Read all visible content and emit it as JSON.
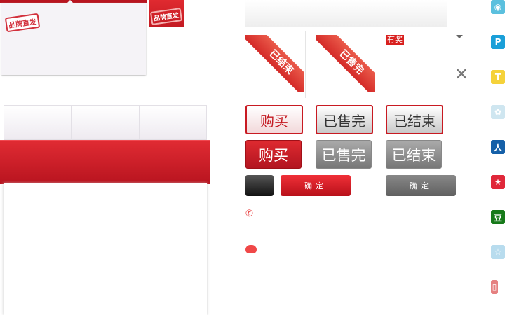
{
  "brand_sign": {
    "label": "品牌直发"
  },
  "ribbons": [
    {
      "label": "已结束"
    },
    {
      "label": "已售完"
    }
  ],
  "prize_badge": "有奖",
  "close_glyph": "✕",
  "buttons_large": [
    {
      "label": "购买"
    },
    {
      "label": "已售完"
    },
    {
      "label": "已结束"
    }
  ],
  "buttons_active": [
    {
      "label": "购买"
    },
    {
      "label": "已售完"
    },
    {
      "label": "已结束"
    }
  ],
  "confirm_red": "确定",
  "confirm_grey": "确定",
  "social_icons": [
    {
      "name": "weibo-icon",
      "color": "#5bc0de",
      "glyph": "◉"
    },
    {
      "name": "tencent-weibo-icon",
      "color": "#1a9fd8",
      "glyph": "P"
    },
    {
      "name": "tianya-icon",
      "color": "#f5d23a",
      "glyph": "T"
    },
    {
      "name": "kaixin-icon",
      "color": "#cfe6f0",
      "glyph": "✿"
    },
    {
      "name": "renren-icon",
      "color": "#1560a8",
      "glyph": "人"
    },
    {
      "name": "qzone-icon",
      "color": "#e0283a",
      "glyph": "★"
    },
    {
      "name": "douban-icon",
      "color": "#177a1a",
      "glyph": "豆"
    },
    {
      "name": "qq-icon",
      "color": "#b8dcee",
      "glyph": "☆"
    },
    {
      "name": "mobile-icon",
      "color": "#e58080",
      "glyph": "▯"
    }
  ],
  "colors": {
    "brand_red": "#c81a22",
    "grey": "#888888"
  }
}
